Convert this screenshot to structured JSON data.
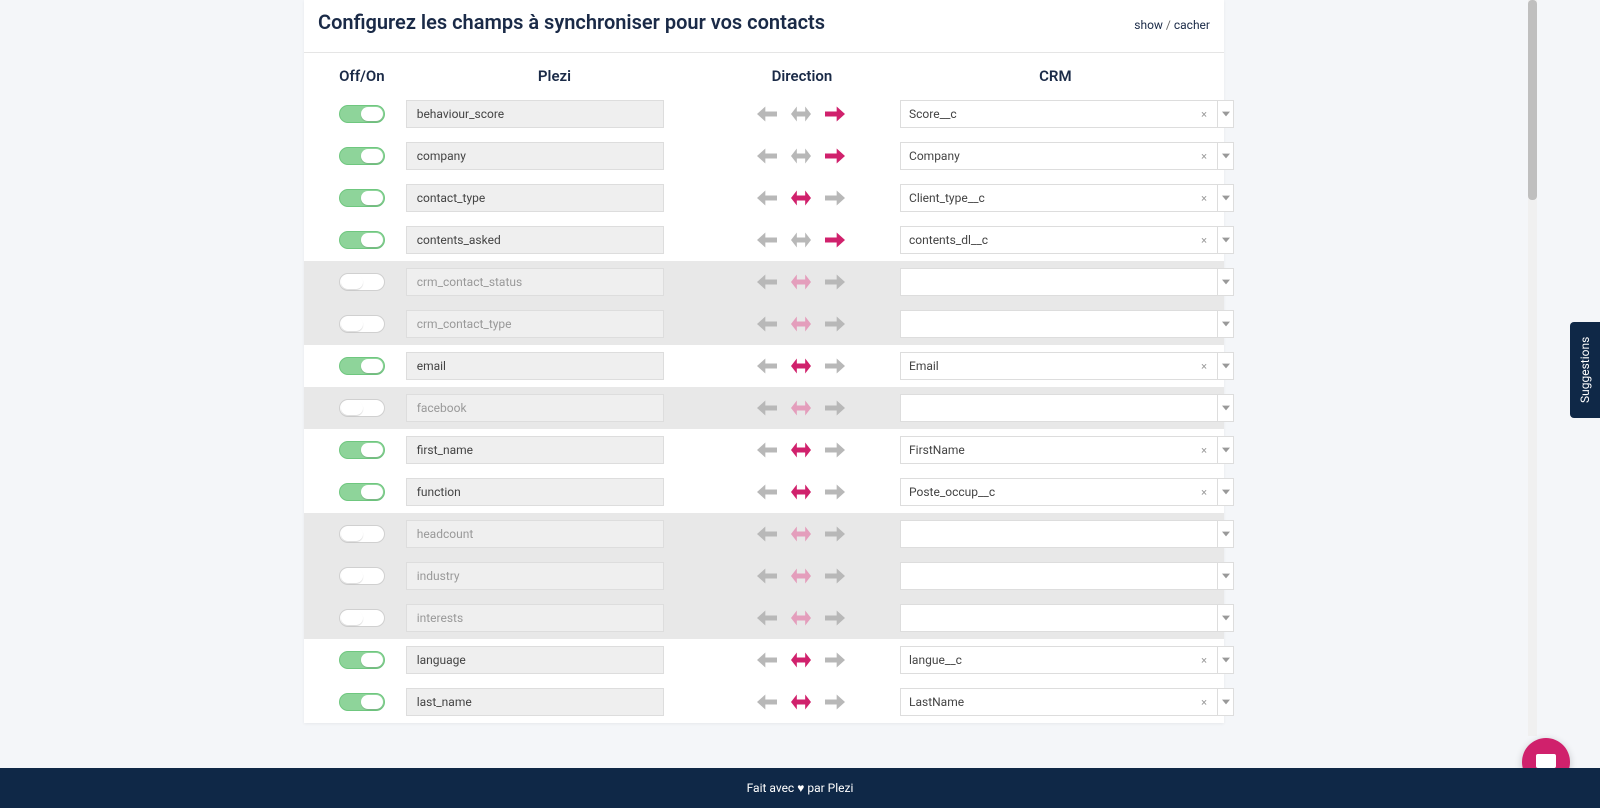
{
  "header": {
    "title": "Configurez les champs à synchroniser pour vos contacts",
    "show_label": "show",
    "separator": " / ",
    "hide_label": "cacher"
  },
  "columns": {
    "onoff": "Off/On",
    "plezi": "Plezi",
    "direction": "Direction",
    "crm": "CRM"
  },
  "rows": [
    {
      "enabled": true,
      "plezi": "behaviour_score",
      "direction": "right",
      "crm": "Score__c"
    },
    {
      "enabled": true,
      "plezi": "company",
      "direction": "right",
      "crm": "Company"
    },
    {
      "enabled": true,
      "plezi": "contact_type",
      "direction": "both",
      "crm": "Client_type__c"
    },
    {
      "enabled": true,
      "plezi": "contents_asked",
      "direction": "right",
      "crm": "contents_dl__c"
    },
    {
      "enabled": false,
      "plezi": "crm_contact_status",
      "direction": "both",
      "crm": ""
    },
    {
      "enabled": false,
      "plezi": "crm_contact_type",
      "direction": "both",
      "crm": ""
    },
    {
      "enabled": true,
      "plezi": "email",
      "direction": "both",
      "crm": "Email"
    },
    {
      "enabled": false,
      "plezi": "facebook",
      "direction": "both",
      "crm": ""
    },
    {
      "enabled": true,
      "plezi": "first_name",
      "direction": "both",
      "crm": "FirstName"
    },
    {
      "enabled": true,
      "plezi": "function",
      "direction": "both",
      "crm": "Poste_occup__c"
    },
    {
      "enabled": false,
      "plezi": "headcount",
      "direction": "both",
      "crm": ""
    },
    {
      "enabled": false,
      "plezi": "industry",
      "direction": "both",
      "crm": ""
    },
    {
      "enabled": false,
      "plezi": "interests",
      "direction": "both",
      "crm": ""
    },
    {
      "enabled": true,
      "plezi": "language",
      "direction": "both",
      "crm": "langue__c"
    },
    {
      "enabled": true,
      "plezi": "last_name",
      "direction": "both",
      "crm": "LastName"
    }
  ],
  "footer": {
    "prefix": "Fait avec ",
    "suffix": " par Plezi"
  },
  "suggestions_label": "Suggestions",
  "clear_symbol": "×"
}
